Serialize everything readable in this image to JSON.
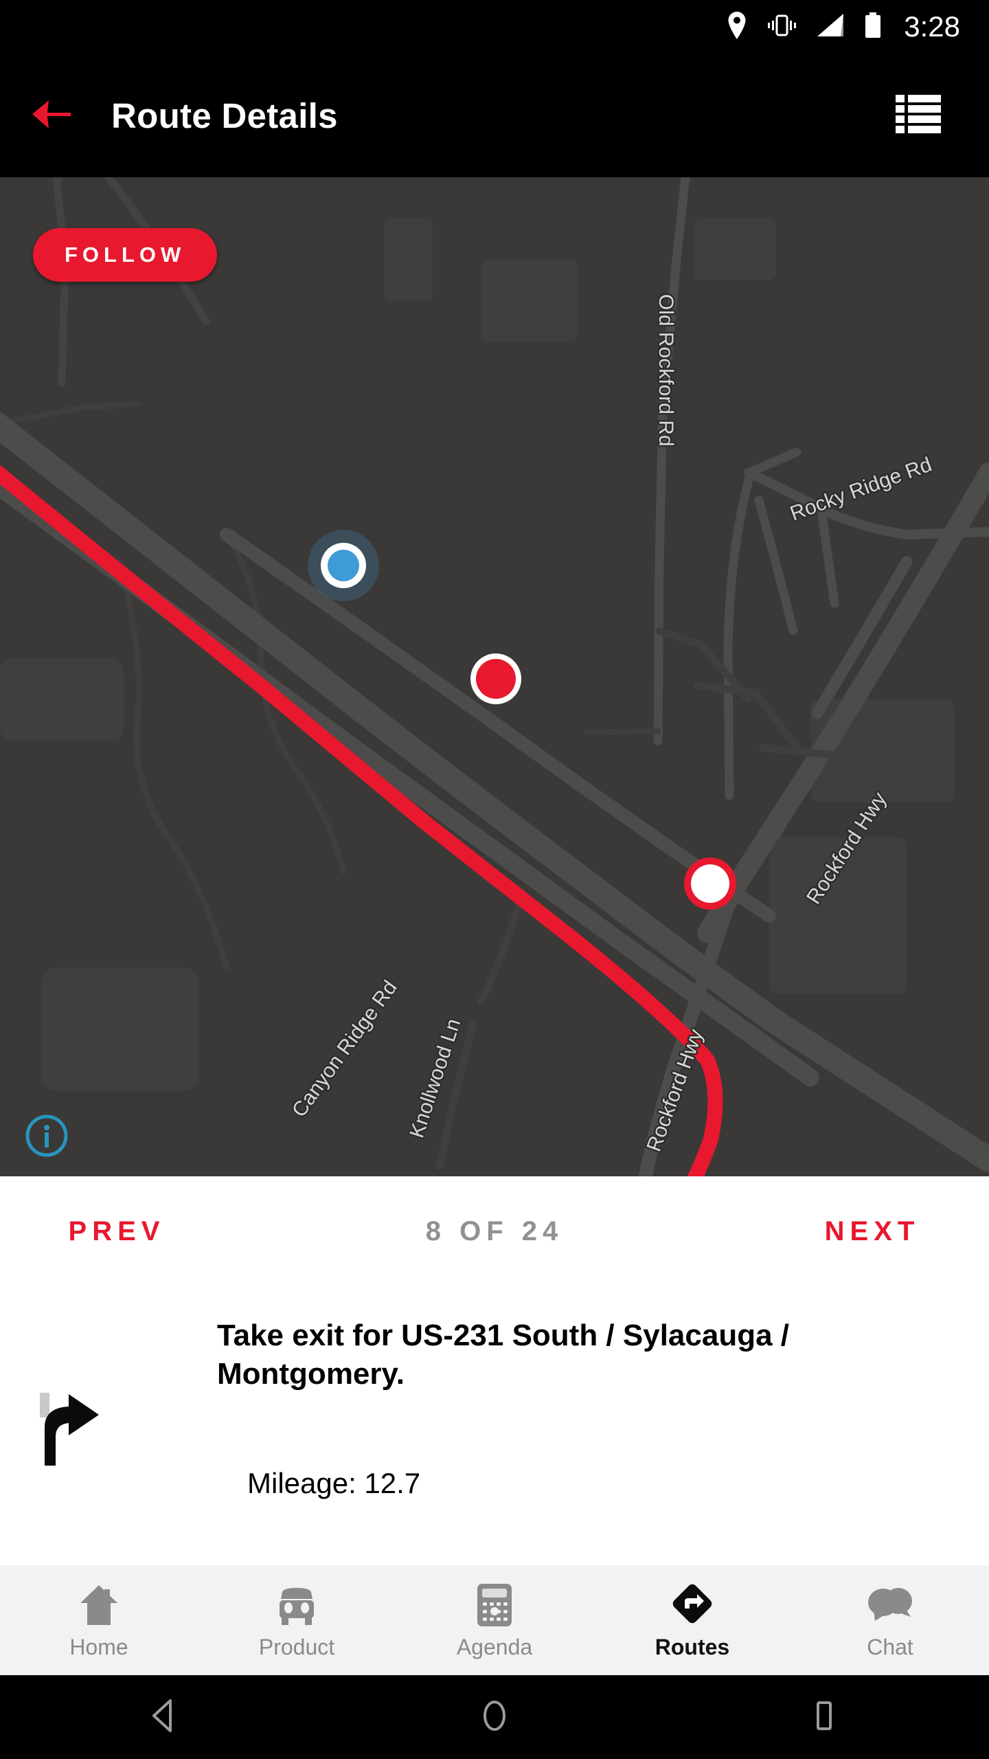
{
  "status_bar": {
    "time": "3:28",
    "icons": [
      "location-pin-icon",
      "vibrate-icon",
      "signal-icon",
      "battery-icon"
    ]
  },
  "app_bar": {
    "title": "Route Details",
    "back_icon": "back-arrow-icon",
    "menu_icon": "list-icon",
    "accent_color": "#E8182F"
  },
  "map": {
    "follow_button_label": "FOLLOW",
    "info_icon": "info-icon",
    "background_color": "#3a3937",
    "route_color": "#E8182F",
    "labels": [
      {
        "name": "Old Rockford Rd"
      },
      {
        "name": "Rocky Ridge Rd"
      },
      {
        "name": "Rockford Hwy"
      },
      {
        "name": "Canyon Ridge Rd"
      },
      {
        "name": "Knollwood Ln"
      },
      {
        "name": "Rockford Hwy"
      }
    ],
    "markers": [
      {
        "type": "current-location",
        "color": "#3E9BD6"
      },
      {
        "type": "waypoint-red",
        "color": "#E8182F"
      },
      {
        "type": "waypoint-white",
        "color": "#FFFFFF"
      }
    ]
  },
  "step_nav": {
    "prev_label": "PREV",
    "counter": "8 OF 24",
    "next_label": "NEXT",
    "current_step": 8,
    "total_steps": 24,
    "accent_color": "#E8182F",
    "counter_color": "#919191"
  },
  "instruction": {
    "maneuver_icon": "exit-right-ramp-icon",
    "text": "Take exit for US-231 South / Sylacauga / Montgomery.",
    "mileage": "Mileage: 12.7"
  },
  "bottom_nav": {
    "items": [
      {
        "label": "Home",
        "icon": "home-icon",
        "active": false
      },
      {
        "label": "Product",
        "icon": "car-icon",
        "active": false
      },
      {
        "label": "Agenda",
        "icon": "calculator-icon",
        "active": false
      },
      {
        "label": "Routes",
        "icon": "route-diamond-icon",
        "active": true
      },
      {
        "label": "Chat",
        "icon": "chat-bubbles-icon",
        "active": false
      }
    ]
  },
  "android_nav": {
    "back_icon": "android-back-icon",
    "home_icon": "android-home-icon",
    "recents_icon": "android-recents-icon"
  }
}
